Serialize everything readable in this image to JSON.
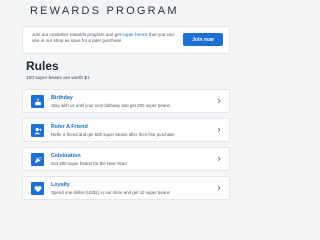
{
  "header": {
    "title": "REWARDS PROGRAM"
  },
  "intro": {
    "text_before": "Join our customer rewards program and get ",
    "text_accent": "super beans",
    "text_after": " that you can use in our shop as save for a later purchase",
    "join_label": "Join now"
  },
  "rules": {
    "heading": "Rules",
    "subheading": "100 super beans are worth $1",
    "items": [
      {
        "title": "Birthday",
        "description": "Stay with us until your next birthday and get 500 super beans",
        "icon": "cake-icon"
      },
      {
        "title": "Refer A Friend",
        "description": "Refer a friend and get 500 super beans after their first purchase",
        "icon": "user-plus-icon"
      },
      {
        "title": "Celebration",
        "description": "Get 300 super beans for the New Year!",
        "icon": "party-icon"
      },
      {
        "title": "Loyalty",
        "description": "Spend one dollar (US$1) in our store and get 10 super beans",
        "icon": "heart-icon"
      }
    ]
  },
  "colors": {
    "accent": "#1d6fd1",
    "background": "#f4f5f7"
  }
}
